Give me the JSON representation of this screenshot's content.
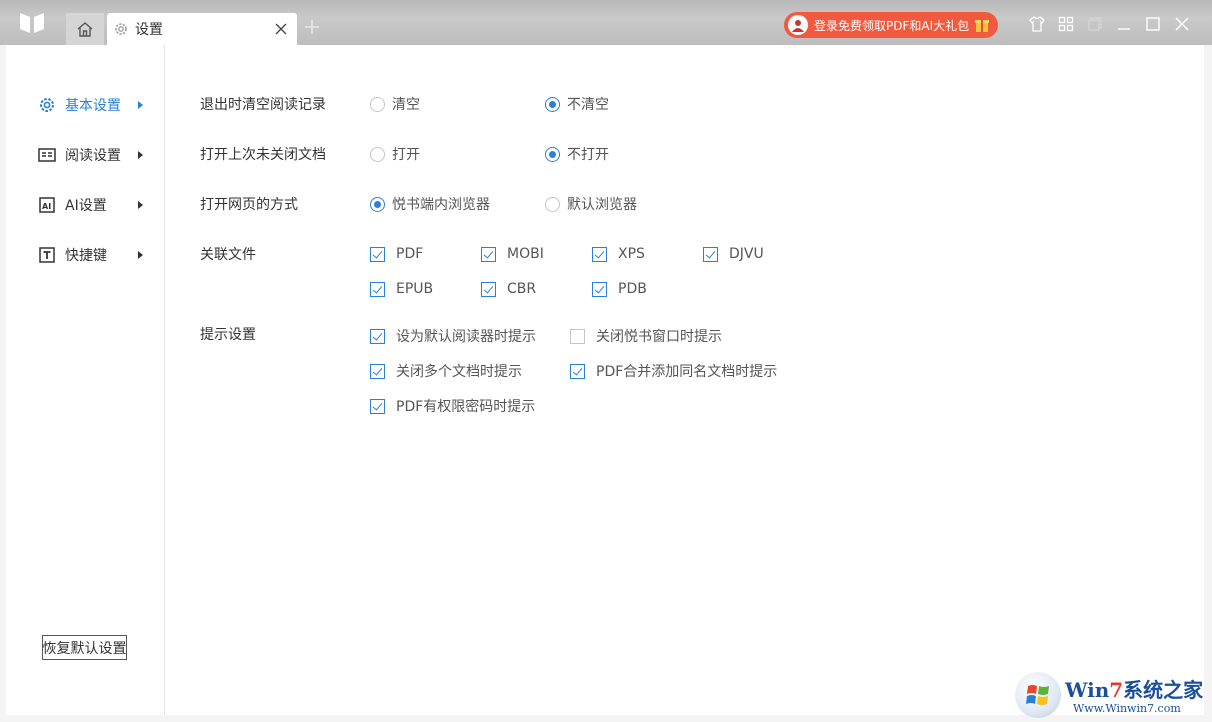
{
  "tab": {
    "title": "设置"
  },
  "promo": {
    "text": "登录免费领取PDF和AI大礼包"
  },
  "sidebar": {
    "items": [
      {
        "label": "基本设置",
        "icon": "gear-icon",
        "active": true
      },
      {
        "label": "阅读设置",
        "icon": "reader-icon",
        "active": false
      },
      {
        "label": "AI设置",
        "icon": "ai-icon",
        "active": false
      },
      {
        "label": "快捷键",
        "icon": "shortcut-icon",
        "active": false
      }
    ],
    "reset_label": "恢复默认设置"
  },
  "settings": {
    "exit_clear": {
      "label": "退出时清空阅读记录",
      "options": [
        {
          "label": "清空",
          "checked": false
        },
        {
          "label": "不清空",
          "checked": true
        }
      ]
    },
    "reopen_last": {
      "label": "打开上次未关闭文档",
      "options": [
        {
          "label": "打开",
          "checked": false
        },
        {
          "label": "不打开",
          "checked": true
        }
      ]
    },
    "open_web": {
      "label": "打开网页的方式",
      "options": [
        {
          "label": "悦书端内浏览器",
          "checked": true
        },
        {
          "label": "默认浏览器",
          "checked": false
        }
      ]
    },
    "assoc_files": {
      "label": "关联文件",
      "items": [
        {
          "label": "PDF",
          "checked": true
        },
        {
          "label": "MOBI",
          "checked": true
        },
        {
          "label": "XPS",
          "checked": true
        },
        {
          "label": "DJVU",
          "checked": true
        },
        {
          "label": "EPUB",
          "checked": true
        },
        {
          "label": "CBR",
          "checked": true
        },
        {
          "label": "PDB",
          "checked": true
        }
      ]
    },
    "prompts": {
      "label": "提示设置",
      "items": [
        {
          "label": "设为默认阅读器时提示",
          "checked": true
        },
        {
          "label": "关闭悦书窗口时提示",
          "checked": false
        },
        {
          "label": "关闭多个文档时提示",
          "checked": true
        },
        {
          "label": "PDF合并添加同名文档时提示",
          "checked": true
        },
        {
          "label": "PDF有权限密码时提示",
          "checked": true
        }
      ]
    }
  },
  "watermark": {
    "title_a": "Win",
    "title_7": "7",
    "title_b": "系统之家",
    "url": "Www.Winwin7.com"
  },
  "colors": {
    "accent": "#2a80d8",
    "promo": "#f15a3f"
  }
}
